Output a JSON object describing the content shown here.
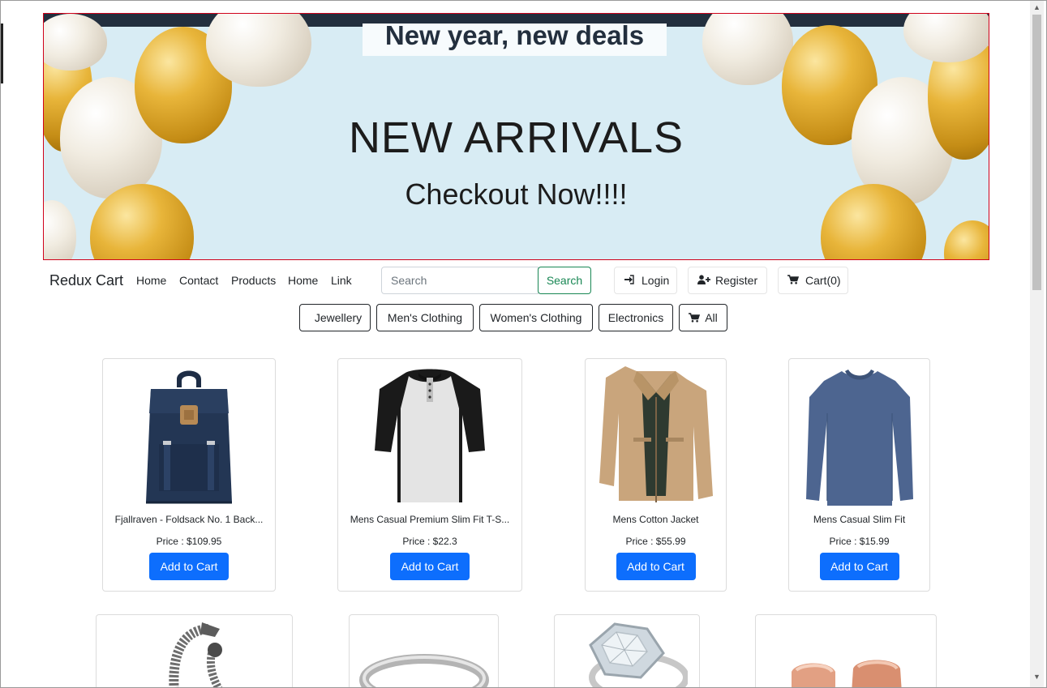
{
  "banner": {
    "tagline": "New year, new deals",
    "title": "NEW ARRIVALS",
    "subtitle": "Checkout Now!!!!"
  },
  "navbar": {
    "brand": "Redux Cart",
    "links": [
      "Home",
      "Contact",
      "Products",
      "Home",
      "Link"
    ],
    "search_placeholder": "Search",
    "search_button": "Search",
    "login": "Login",
    "register": "Register",
    "cart": "Cart(0)"
  },
  "categories": [
    "Jewellery",
    "Men's Clothing",
    "Women's Clothing",
    "Electronics",
    "All"
  ],
  "products": [
    {
      "title": "Fjallraven - Foldsack No. 1 Back...",
      "price": "Price : $109.95",
      "button": "Add to Cart",
      "image": "backpack"
    },
    {
      "title": "Mens Casual Premium Slim Fit T-S...",
      "price": "Price : $22.3",
      "button": "Add to Cart",
      "image": "raglan-tshirt"
    },
    {
      "title": "Mens Cotton Jacket",
      "price": "Price : $55.99",
      "button": "Add to Cart",
      "image": "cotton-jacket"
    },
    {
      "title": "Mens Casual Slim Fit",
      "price": "Price : $15.99",
      "button": "Add to Cart",
      "image": "long-sleeve-shirt"
    }
  ],
  "products_row2": [
    {
      "image": "dragon-bracelet"
    },
    {
      "image": "silver-ring"
    },
    {
      "image": "diamond-ring"
    },
    {
      "image": "rose-gold-rings"
    }
  ],
  "colors": {
    "primary": "#0d6efd",
    "success": "#198754",
    "banner_bg": "#d8ecf4",
    "banner_border": "#d0021b"
  }
}
